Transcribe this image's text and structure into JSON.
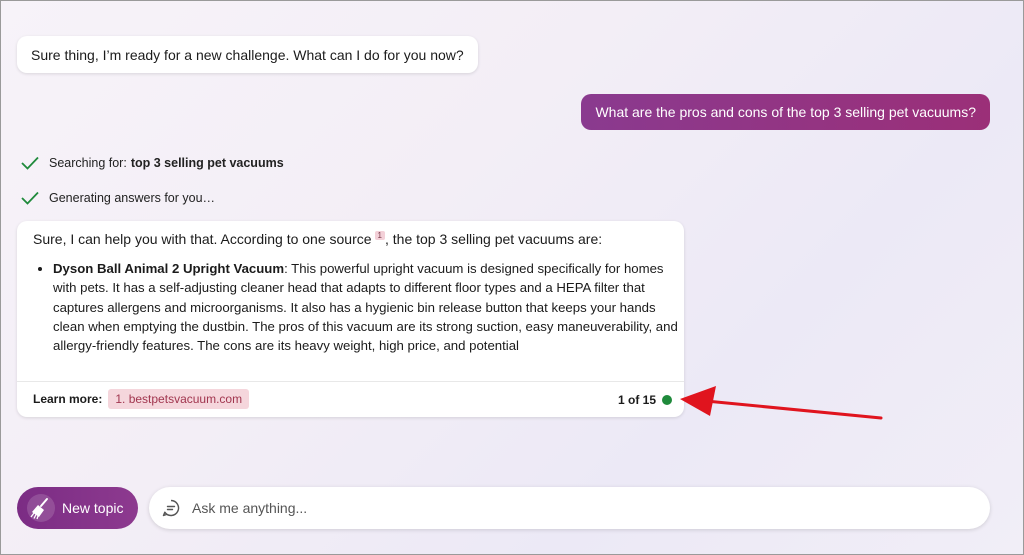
{
  "conversation": {
    "bot_greeting": "Sure thing, I’m ready for a new challenge. What can I do for you now?",
    "user_message": "What are the pros and cons of the top 3 selling pet vacuums?"
  },
  "status": {
    "searching_label": "Searching for:",
    "searching_query": "top 3 selling pet vacuums",
    "generating": "Generating answers for you…"
  },
  "answer": {
    "intro_before": "Sure, I can help you with that. According to one source",
    "citation": "1",
    "intro_after": ", the top 3 selling pet vacuums are:",
    "items": [
      {
        "title": "Dyson Ball Animal 2 Upright Vacuum",
        "text": ": This powerful upright vacuum is designed specifically for homes with pets. It has a self-adjusting cleaner head that adapts to different floor types and a HEPA filter that captures allergens and microorganisms. It also has a hygienic bin release button that keeps your hands clean when emptying the dustbin. The pros of this vacuum are its strong suction, easy maneuverability, and allergy-friendly features. The cons are its heavy weight, high price, and potential"
      }
    ],
    "learn_more_label": "Learn more:",
    "source_link": "1. bestpetsvacuum.com",
    "counter": "1 of 15"
  },
  "composer": {
    "new_topic": "New topic",
    "placeholder": "Ask me anything..."
  },
  "colors": {
    "accent": "#8a3a8f",
    "check": "#1f8a3b",
    "arrow": "#e0141e"
  }
}
